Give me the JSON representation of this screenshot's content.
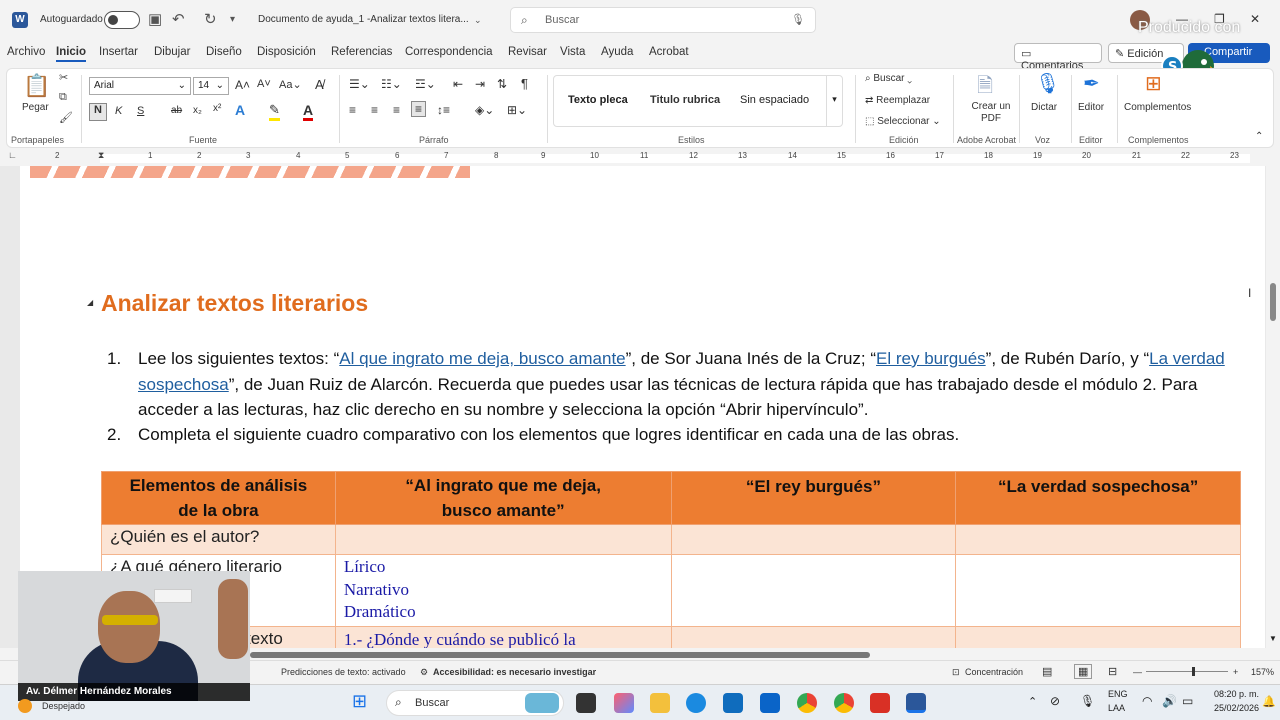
{
  "titlebar": {
    "autosave_label": "Autoguardado",
    "doc_title": "Documento de ayuda_1 -Analizar textos litera...",
    "search_placeholder": "Buscar",
    "watermark": "Producido con"
  },
  "menu": {
    "items": [
      "Archivo",
      "Inicio",
      "Insertar",
      "Dibujar",
      "Diseño",
      "Disposición",
      "Referencias",
      "Correspondencia",
      "Revisar",
      "Vista",
      "Ayuda",
      "Acrobat"
    ],
    "active": "Inicio",
    "comments_label": "Comentarios",
    "editing_label": "Edición",
    "share_label": "Compartir"
  },
  "ribbon": {
    "paste_label": "Pegar",
    "font_name": "Arial",
    "font_size": "14",
    "bold_glyph": "N",
    "italic_glyph": "K",
    "underline_glyph": "S",
    "styles": [
      "Texto pleca",
      "Titulo rubrica",
      "Sin espaciado"
    ],
    "find_label": "Buscar",
    "replace_label": "Reemplazar",
    "select_label": "Seleccionar",
    "create_pdf_label": "Crear un PDF",
    "dictate_label": "Dictar",
    "editor_label": "Editor",
    "addins_label": "Complementos",
    "groups": {
      "clipboard": "Portapapeles",
      "font": "Fuente",
      "paragraph": "Párrafo",
      "styles": "Estilos",
      "editing": "Edición",
      "adobe": "Adobe Acrobat",
      "voice": "Voz",
      "editor": "Editor",
      "addins": "Complementos"
    }
  },
  "ruler": {
    "numbers": [
      "2",
      "1",
      "1",
      "2",
      "3",
      "4",
      "5",
      "6",
      "7",
      "8",
      "9",
      "10",
      "11",
      "12",
      "13",
      "14",
      "15",
      "16",
      "17",
      "18",
      "19",
      "20",
      "21",
      "22",
      "23"
    ]
  },
  "document": {
    "heading": "Analizar textos literarios",
    "item1": {
      "num": "1.",
      "t1": "Lee los siguientes textos: “",
      "link1": "Al que ingrato me deja, busco amante",
      "t2": "”, de Sor Juana Inés de la Cruz; “",
      "link2": "El rey burgués",
      "t3": "”, de Rubén Darío, y “",
      "link3": "La verdad sospechosa",
      "t4": "”, de Juan Ruiz de Alarcón. Recuerda que puedes usar las técnicas de lectura rápida que has trabajado desde el módulo 2. Para acceder a las lecturas, haz clic derecho en su nombre y selecciona la opción “Abrir hipervínculo”."
    },
    "item2": {
      "num": "2.",
      "text": "Completa el siguiente cuadro comparativo con los elementos que logres identificar en cada una de las obras."
    },
    "table": {
      "headers": [
        "Elementos de análisis de la obra",
        "“Al ingrato que me deja, busco amante”",
        "“El rey burgués”",
        "“La verdad sospechosa”"
      ],
      "row1": "¿Quién es el autor?",
      "row2": "¿A qué género literario",
      "row2_options": [
        "Lírico",
        "Narrativo",
        "Dramático"
      ],
      "row3": "texto",
      "row3_note": "1.- ¿Dónde y cuándo se publicó la"
    }
  },
  "statusbar": {
    "predictions": "Predicciones de texto: activado",
    "accessibility": "Accesibilidad: es necesario investigar",
    "focus": "Concentración",
    "zoom": "157%"
  },
  "taskbar": {
    "search_placeholder": "Buscar",
    "lang1": "ENG",
    "lang2": "LAA",
    "time": "08:20 p. m.",
    "date": "25/02/2026",
    "weather": "Despejado"
  },
  "webcam": {
    "name": "Av. Délmer Hernández Morales"
  },
  "colors": {
    "heading": "#e06c1e",
    "table_header": "#ed7d31",
    "table_row_alt": "#fbe4d5",
    "link": "#1f5e9f",
    "share": "#185abd"
  }
}
